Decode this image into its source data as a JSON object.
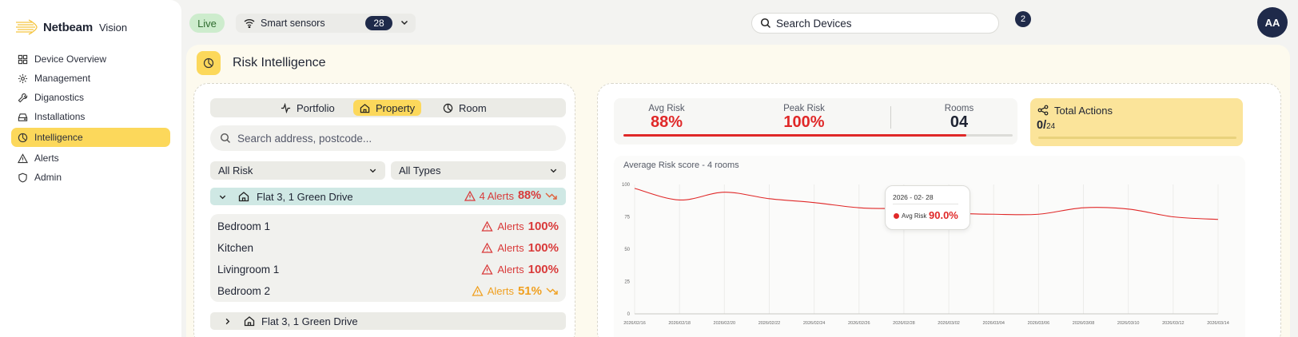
{
  "brand": {
    "name": "Netbeam",
    "sub": "Vision"
  },
  "sidebar": {
    "items": [
      {
        "label": "Device Overview",
        "icon": "grid-icon"
      },
      {
        "label": "Management",
        "icon": "gear-icon"
      },
      {
        "label": "Diganostics",
        "icon": "wrench-icon"
      },
      {
        "label": "Installations",
        "icon": "drive-icon"
      },
      {
        "label": "Intelligence",
        "icon": "chart-pie-icon",
        "active": true
      },
      {
        "label": "Alerts",
        "icon": "warning-icon"
      },
      {
        "label": "Admin",
        "icon": "shield-icon"
      }
    ]
  },
  "topbar": {
    "live": "Live",
    "sensors_label": "Smart sensors",
    "sensors_count": "28",
    "search_placeholder": "Search Devices",
    "notifications": "2",
    "avatar": "AA"
  },
  "page": {
    "title": "Risk Intelligence"
  },
  "left": {
    "tabs": [
      "Portfolio",
      "Property",
      "Room"
    ],
    "active_tab": "Property",
    "search_placeholder": "Search address, postcode...",
    "filter_risk": "All Risk",
    "filter_types": "All Types",
    "property": {
      "name": "Flat 3, 1 Green Drive",
      "alerts": "4 Alerts",
      "pct": "88%"
    },
    "rooms": [
      {
        "name": "Bedroom 1",
        "alerts": "Alerts",
        "pct": "100%",
        "level": "red"
      },
      {
        "name": "Kitchen",
        "alerts": "Alerts",
        "pct": "100%",
        "level": "red"
      },
      {
        "name": "Livingroom 1",
        "alerts": "Alerts",
        "pct": "100%",
        "level": "red"
      },
      {
        "name": "Bedroom 2",
        "alerts": "Alerts",
        "pct": "51%",
        "level": "orange"
      }
    ],
    "property2": {
      "name": "Flat 3, 1 Green Drive"
    }
  },
  "stats": {
    "avg_label": "Avg Risk",
    "avg_value": "88%",
    "peak_label": "Peak Risk",
    "peak_value": "100%",
    "rooms_label": "Rooms",
    "rooms_value": "04",
    "avg_fraction": 0.88
  },
  "actions": {
    "title": "Total Actions",
    "done": "0/",
    "total": "24",
    "progress": 0
  },
  "colors": {
    "accent": "#fcd85b",
    "risk": "#e02828",
    "navy": "#1f2a4a",
    "teal": "#cfe8e4"
  },
  "chart_data": {
    "type": "line",
    "title": "Average  Risk score - 4 rooms",
    "ylim": [
      0,
      100
    ],
    "yticks": [
      0,
      25,
      50,
      75,
      100
    ],
    "x": [
      "2026/02/16",
      "2026/02/18",
      "2026/02/20",
      "2026/02/22",
      "2026/02/24",
      "2026/02/26",
      "2026/02/28",
      "2026/03/02",
      "2026/03/04",
      "2026/03/06",
      "2026/03/08",
      "2026/03/10",
      "2026/03/12",
      "2026/03/14"
    ],
    "series": [
      {
        "name": "Avg Risk",
        "values": [
          97,
          88,
          94,
          89,
          86,
          82,
          81,
          78,
          77,
          77,
          82,
          81,
          75,
          73
        ]
      }
    ],
    "tooltip": {
      "date": "2026 - 02- 28",
      "label": "Avg Risk",
      "value": "90.0%",
      "index": 6
    }
  }
}
